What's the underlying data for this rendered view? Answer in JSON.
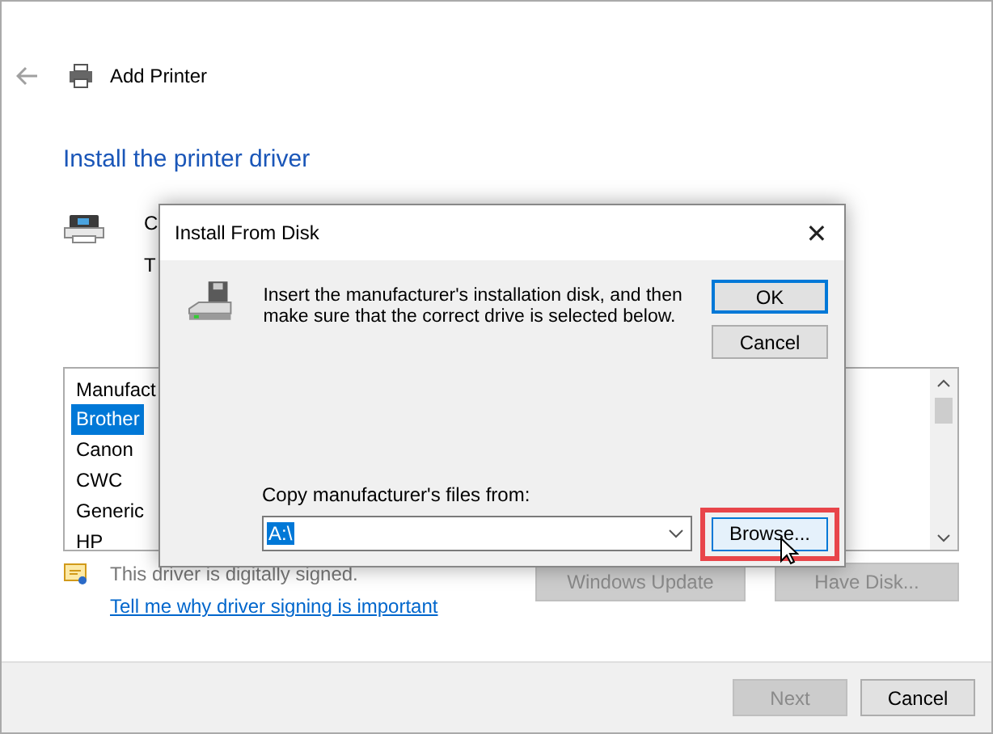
{
  "window": {
    "title": "Add Printer"
  },
  "heading": "Install the printer driver",
  "hidden_texts": [
    "C",
    "T"
  ],
  "manufacturer_list": {
    "header": "Manufact",
    "items": [
      {
        "label": "Brother",
        "selected": true
      },
      {
        "label": "Canon",
        "selected": false
      },
      {
        "label": "CWC",
        "selected": false
      },
      {
        "label": "Generic",
        "selected": false
      },
      {
        "label": "HP",
        "selected": false
      }
    ]
  },
  "signature_text": "This driver is digitally signed.",
  "signature_link": "Tell me why driver signing is important",
  "side_buttons": [
    {
      "label": "Windows Update",
      "disabled": true
    },
    {
      "label": "Have Disk...",
      "disabled": true
    }
  ],
  "footer_buttons": [
    {
      "label": "Next",
      "disabled": true
    },
    {
      "label": "Cancel",
      "disabled": false
    }
  ],
  "dialog": {
    "title": "Install From Disk",
    "close": "✕",
    "message": "Insert the manufacturer's installation disk, and then make sure that the correct drive is selected below.",
    "buttons": [
      {
        "label": "OK",
        "default": true
      },
      {
        "label": "Cancel",
        "default": false
      }
    ],
    "copy_label": "Copy manufacturer's files from:",
    "path_value": "A:\\",
    "browse": {
      "label": "Browse...",
      "highlighted": true
    }
  }
}
